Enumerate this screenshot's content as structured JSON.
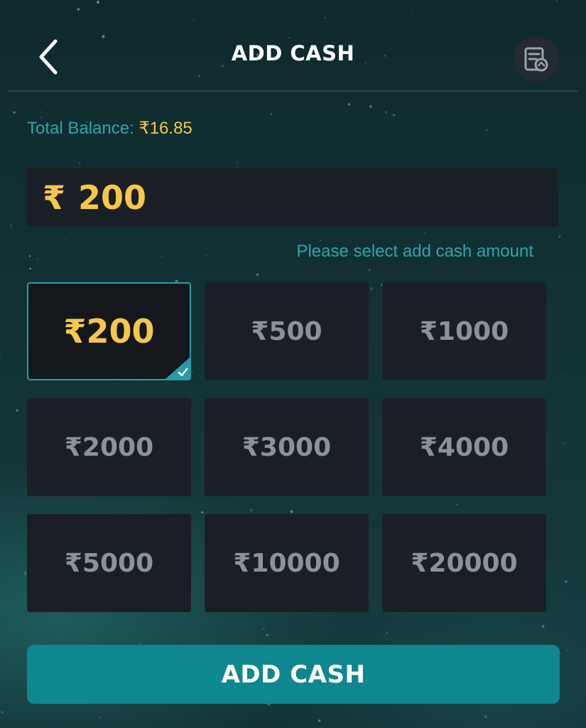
{
  "header": {
    "title": "ADD CASH",
    "back_icon": "chevron-left-icon",
    "history_icon": "transaction-history-icon"
  },
  "balance": {
    "label": "Total Balance: ",
    "value": "₹16.85"
  },
  "amount_input": {
    "currency": "₹",
    "value": "200"
  },
  "hint": "Please select add cash amount",
  "options": [
    {
      "label": "₹200",
      "selected": true
    },
    {
      "label": "₹500",
      "selected": false
    },
    {
      "label": "₹1000",
      "selected": false
    },
    {
      "label": "₹2000",
      "selected": false
    },
    {
      "label": "₹3000",
      "selected": false
    },
    {
      "label": "₹4000",
      "selected": false
    },
    {
      "label": "₹5000",
      "selected": false
    },
    {
      "label": "₹10000",
      "selected": false
    },
    {
      "label": "₹20000",
      "selected": false
    }
  ],
  "add_button": {
    "label": "ADD CASH"
  },
  "colors": {
    "accent_teal": "#0f8791",
    "gold": "#f5c84a",
    "tile_bg": "#1a1f26"
  }
}
